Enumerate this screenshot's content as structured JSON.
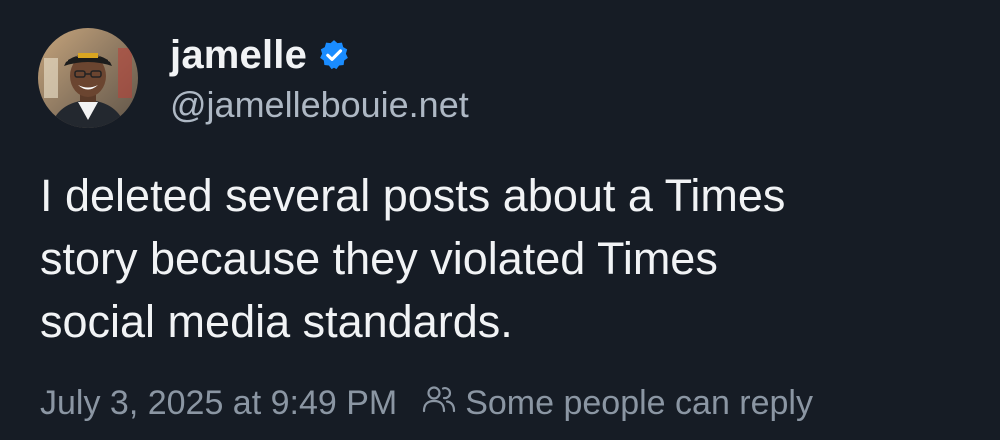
{
  "author": {
    "display_name": "jamelle",
    "handle": "@jamellebouie.net",
    "avatar_icon": "profile-photo",
    "verified_icon": "verified-check-icon",
    "verified_color": "#1a8cff"
  },
  "post": {
    "text_lines": [
      "I deleted several posts about a Times",
      "story because they violated Times",
      "social media standards."
    ],
    "timestamp": "July 3, 2025 at 9:49 PM",
    "reply_setting": "Some people can reply",
    "reply_icon": "people-icon"
  },
  "theme": {
    "background": "#161c25",
    "text_primary": "#f1f3f5",
    "text_secondary": "#aeb8c4",
    "text_meta": "#8b96a3"
  }
}
